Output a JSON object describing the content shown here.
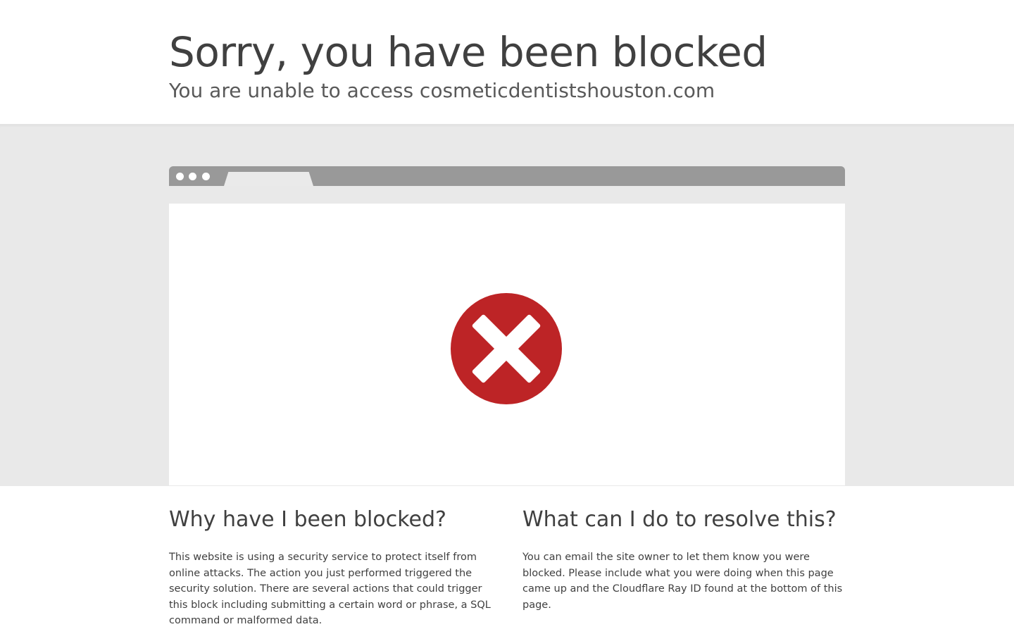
{
  "header": {
    "title": "Sorry, you have been blocked",
    "subtitle": "You are unable to access cosmeticdentistshouston.com"
  },
  "browser_illustration": {
    "icon": "error-x-circle-icon",
    "icon_color": "#bd2426"
  },
  "why_blocked": {
    "heading": "Why have I been blocked?",
    "text": "This website is using a security service to protect itself from online attacks. The action you just performed triggered the security solution. There are several actions that could trigger this block including submitting a certain word or phrase, a SQL command or malformed data."
  },
  "resolve": {
    "heading": "What can I do to resolve this?",
    "text": "You can email the site owner to let them know you were blocked. Please include what you were doing when this page came up and the Cloudflare Ray ID found at the bottom of this page."
  },
  "colors": {
    "band_background": "#e9e9e9",
    "browser_bar": "#999999",
    "text": "#404040"
  }
}
